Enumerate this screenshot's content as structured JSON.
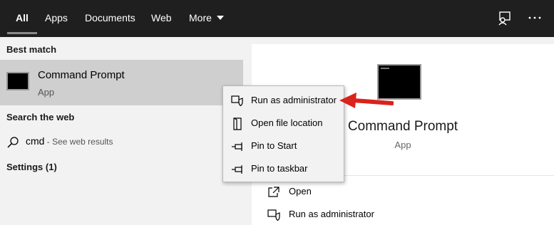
{
  "tabs": [
    {
      "label": "All",
      "active": true
    },
    {
      "label": "Apps",
      "active": false
    },
    {
      "label": "Documents",
      "active": false
    },
    {
      "label": "Web",
      "active": false
    },
    {
      "label": "More",
      "active": false
    }
  ],
  "top_icons": [
    "feedback-icon",
    "more-options-icon"
  ],
  "best_match": {
    "heading": "Best match",
    "title": "Command Prompt",
    "subtitle": "App"
  },
  "search_web": {
    "heading": "Search the web",
    "query": "cmd",
    "suffix": " - See web results"
  },
  "settings": {
    "label": "Settings (1)"
  },
  "context_menu": {
    "items": [
      {
        "label": "Run as administrator",
        "icon": "shield-icon"
      },
      {
        "label": "Open file location",
        "icon": "folder-location-icon"
      },
      {
        "label": "Pin to Start",
        "icon": "pin-icon"
      },
      {
        "label": "Pin to taskbar",
        "icon": "pin-icon"
      }
    ]
  },
  "preview": {
    "title": "Command Prompt",
    "subtitle": "App",
    "actions": [
      {
        "label": "Open",
        "icon": "open-icon"
      },
      {
        "label": "Run as administrator",
        "icon": "shield-icon"
      }
    ]
  },
  "colors": {
    "topbar": "#1f1f1f",
    "selected_row": "#cfcfcf",
    "annotation_arrow": "#d9231c"
  }
}
